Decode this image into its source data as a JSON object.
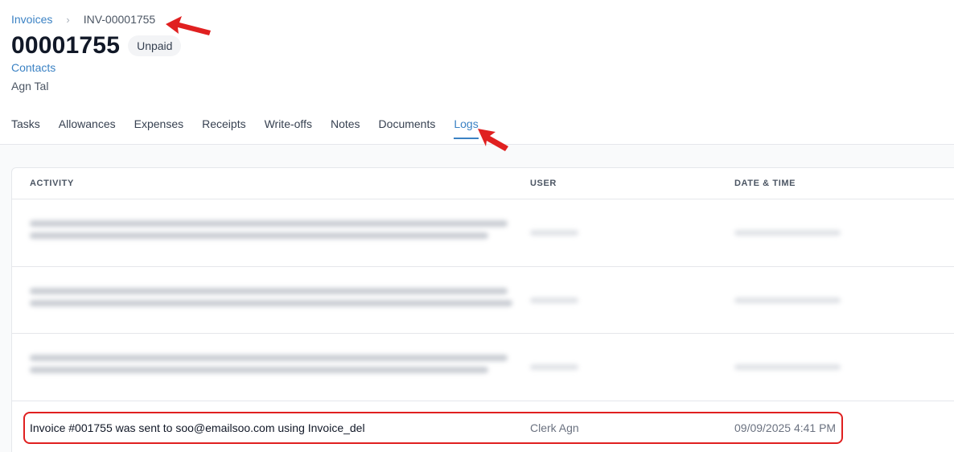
{
  "breadcrumb": {
    "parent": "Invoices",
    "separator": "›",
    "current": "INV-00001755"
  },
  "invoice": {
    "number": "00001755",
    "status": "Unpaid",
    "contacts_label": "Contacts",
    "contact_name": "Agn Tal"
  },
  "tabs": [
    {
      "label": "Tasks",
      "active": false
    },
    {
      "label": "Allowances",
      "active": false
    },
    {
      "label": "Expenses",
      "active": false
    },
    {
      "label": "Receipts",
      "active": false
    },
    {
      "label": "Write-offs",
      "active": false
    },
    {
      "label": "Notes",
      "active": false
    },
    {
      "label": "Documents",
      "active": false
    },
    {
      "label": "Logs",
      "active": true
    }
  ],
  "logs": {
    "columns": {
      "activity": "ACTIVITY",
      "user": "USER",
      "date_time": "DATE & TIME"
    },
    "visible_row": {
      "activity": "Invoice #001755 was sent to soo@emailsoo.com using Invoice_del",
      "user": "Clerk Agn",
      "date_time": "09/09/2025 4:41 PM"
    }
  },
  "colors": {
    "accent": "#3b82c4",
    "annotation": "#e02020"
  },
  "icons": {
    "breadcrumb_separator": "chevron-right-icon",
    "annotation_arrow": "red-arrow-icon"
  }
}
